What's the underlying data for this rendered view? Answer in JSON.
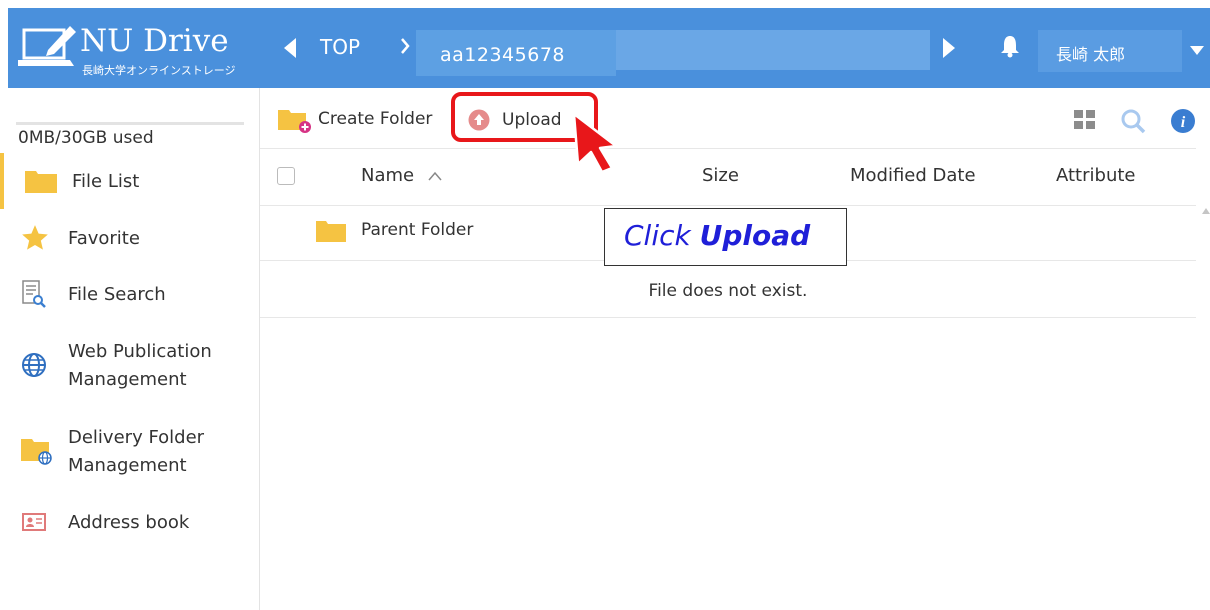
{
  "app": {
    "logo_title": "NU Drive",
    "logo_subtitle": "長崎大学オンラインストレージ"
  },
  "header": {
    "breadcrumb_root": "TOP",
    "breadcrumb_current": "aa12345678",
    "user_name": "長崎 太郎"
  },
  "sidebar": {
    "quota": "0MB/30GB used",
    "quota_used_fraction": 0,
    "items": [
      {
        "label": "File List",
        "icon": "folder-icon",
        "active": true
      },
      {
        "label": "Favorite",
        "icon": "star-icon"
      },
      {
        "label": "File Search",
        "icon": "file-search-icon"
      },
      {
        "label_line1": "Web Publication",
        "label_line2": "Management",
        "icon": "globe-icon"
      },
      {
        "label_line1": "Delivery Folder",
        "label_line2": "Management",
        "icon": "delivery-folder-icon"
      },
      {
        "label": "Address book",
        "icon": "address-book-icon"
      }
    ]
  },
  "toolbar": {
    "create_folder_label": "Create Folder",
    "upload_label": "Upload"
  },
  "table": {
    "columns": [
      "Name",
      "Size",
      "Modified Date",
      "Attribute"
    ],
    "sort_indicator": "^",
    "rows": [
      {
        "name": "Parent Folder"
      }
    ],
    "empty_message": "File does not exist."
  },
  "annotation": {
    "callout_prefix": "Click ",
    "callout_emphasis": "Upload"
  },
  "colors": {
    "header_bg": "#4a90dc",
    "accent_yellow": "#f5c342",
    "highlight_red": "#e8171a",
    "callout_blue": "#1f1fd8"
  }
}
